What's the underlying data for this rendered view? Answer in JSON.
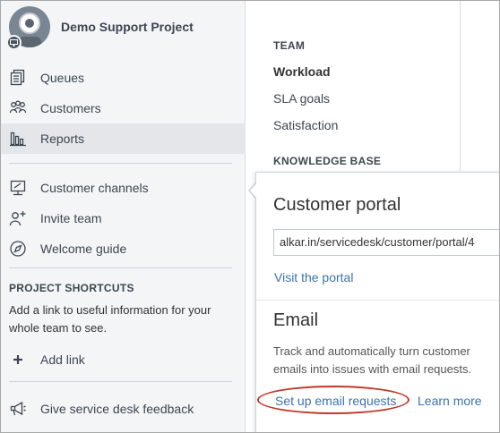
{
  "project": {
    "title": "Demo Support Project"
  },
  "sidebar": {
    "items": [
      {
        "label": "Queues",
        "icon": "queues-icon"
      },
      {
        "label": "Customers",
        "icon": "customers-icon"
      },
      {
        "label": "Reports",
        "icon": "reports-icon",
        "active": true
      },
      {
        "label": "Customer channels",
        "icon": "monitor-icon"
      },
      {
        "label": "Invite team",
        "icon": "add-person-icon"
      },
      {
        "label": "Welcome guide",
        "icon": "compass-icon"
      }
    ],
    "shortcuts": {
      "title": "PROJECT SHORTCUTS",
      "description": "Add a link to useful information for your whole team to see.",
      "add_link": "Add link"
    },
    "feedback": "Give service desk feedback"
  },
  "reports": {
    "team_heading": "TEAM",
    "team_items": [
      "Workload",
      "SLA goals",
      "Satisfaction"
    ],
    "kb_heading": "KNOWLEDGE BASE"
  },
  "popover": {
    "portal_title": "Customer portal",
    "portal_url": "alkar.in/servicedesk/customer/portal/4",
    "visit_label": "Visit the portal",
    "email_title": "Email",
    "email_description": "Track and automatically turn customer emails into issues with email requests.",
    "setup_label": "Set up email requests",
    "learn_more": "Learn more"
  },
  "colors": {
    "sidebar_bg": "#f4f5f7",
    "active_bg": "#e4e6ea",
    "link": "#3b73af",
    "annotation": "#c0392b"
  }
}
